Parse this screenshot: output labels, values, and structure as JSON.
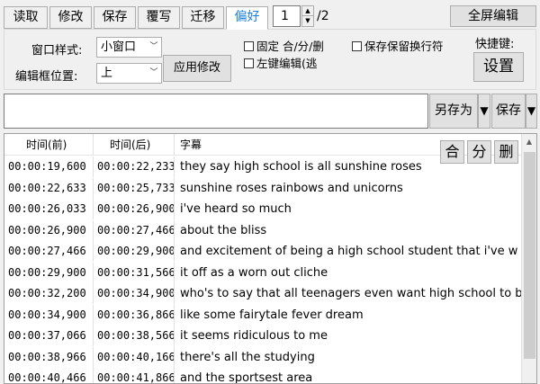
{
  "tabs": [
    {
      "label": "读取"
    },
    {
      "label": "修改"
    },
    {
      "label": "保存"
    },
    {
      "label": "覆写"
    },
    {
      "label": "迁移"
    },
    {
      "label": "偏好",
      "active": true
    }
  ],
  "pager": {
    "current": "1",
    "total": "/2"
  },
  "fullscreen_label": "全屏编辑",
  "settings": {
    "window_style_label": "窗口样式:",
    "window_style_value": "小窗口",
    "editor_pos_label": "编辑框位置:",
    "editor_pos_value": "上",
    "apply_label": "应用修改",
    "fix_check": "固定 合/分/删",
    "left_edit_check": "左键编辑(逃",
    "keep_newline_check": "保存保留换行符",
    "shortcut_label": "快捷键:",
    "setup_label": "设置"
  },
  "editor": {
    "text": "",
    "save_as_label": "另存为",
    "save_label": "保存",
    "dropdown_glyph": "▼"
  },
  "table": {
    "headers": {
      "start": "时间(前)",
      "end": "时间(后)",
      "subtitle": "字幕"
    },
    "actions": {
      "merge": "合",
      "split": "分",
      "delete": "删"
    },
    "rows": [
      {
        "start": "00:00:19,600",
        "end": "00:00:22,233",
        "text": "they say high school is all sunshine roses"
      },
      {
        "start": "00:00:22,633",
        "end": "00:00:25,733",
        "text": "sunshine roses rainbows and unicorns"
      },
      {
        "start": "00:00:26,033",
        "end": "00:00:26,900",
        "text": "i've heard so much"
      },
      {
        "start": "00:00:26,900",
        "end": "00:00:27,466",
        "text": "about the bliss"
      },
      {
        "start": "00:00:27,466",
        "end": "00:00:29,900",
        "text": "and excitement of being a high school student that i've w"
      },
      {
        "start": "00:00:29,900",
        "end": "00:00:31,566",
        "text": "it off as a worn out cliche"
      },
      {
        "start": "00:00:32,200",
        "end": "00:00:34,900",
        "text": "who's to say that all teenagers even want high school to b"
      },
      {
        "start": "00:00:34,900",
        "end": "00:00:36,866",
        "text": "like some fairytale fever dream"
      },
      {
        "start": "00:00:37,066",
        "end": "00:00:38,566",
        "text": "it seems ridiculous to me"
      },
      {
        "start": "00:00:38,966",
        "end": "00:00:40,166",
        "text": "there's all the studying"
      },
      {
        "start": "00:00:40,466",
        "end": "00:00:41,866",
        "text": "and the sportsest area"
      }
    ]
  }
}
